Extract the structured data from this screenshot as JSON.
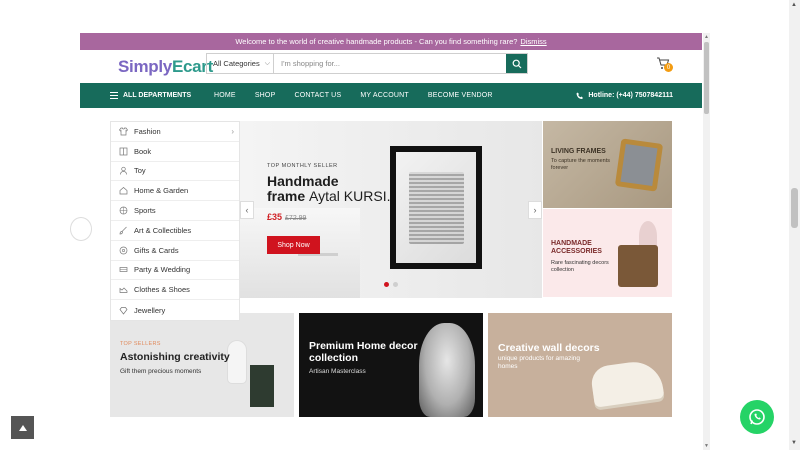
{
  "announcement": {
    "text": "Welcome to the world of creative handmade products - Can you find something rare?",
    "dismiss": "Dismiss"
  },
  "header": {
    "logo_part1": "Simply",
    "logo_part2": "Ecart",
    "category_select": "All Categories",
    "search_placeholder": "I'm shopping for...",
    "cart_count": "0"
  },
  "nav": {
    "departments": "ALL DEPARTMENTS",
    "items": [
      "HOME",
      "SHOP",
      "CONTACT US",
      "MY ACCOUNT",
      "BECOME VENDOR"
    ],
    "hotline": "Hotline: (+44) 7507842111"
  },
  "sidebar": {
    "items": [
      "Fashion",
      "Book",
      "Toy",
      "Home & Garden",
      "Sports",
      "Art & Collectibles",
      "Gifts & Cards",
      "Party & Wedding",
      "Clothes & Shoes",
      "Jewellery"
    ]
  },
  "hero": {
    "small": "TOP MONTHLY SELLER",
    "title_bold": "Handmade",
    "title_line2_bold": "frame",
    "title_line2_light": "Aytal KURSI.",
    "price": "£35",
    "old_price": "£72.99",
    "button": "Shop Now"
  },
  "side_banners": [
    {
      "title": "LIVING FRAMES",
      "subtitle": "To capture the moments forever"
    },
    {
      "title": "HANDMADE ACCESSORIES",
      "subtitle": "Rare fascinating decors collection"
    }
  ],
  "bottom_banners": [
    {
      "small": "TOP SELLERS",
      "title": "Astonishing creativity",
      "subtitle": "Gift them precious moments"
    },
    {
      "title": "Premium Home decor collection",
      "subtitle": "Artisan Masterclass"
    },
    {
      "title": "Creative wall decors",
      "subtitle": "unique products for amazing homes"
    }
  ],
  "colors": {
    "topbar": "#a8679e",
    "nav": "#176b5b",
    "accent_red": "#d0131e"
  }
}
